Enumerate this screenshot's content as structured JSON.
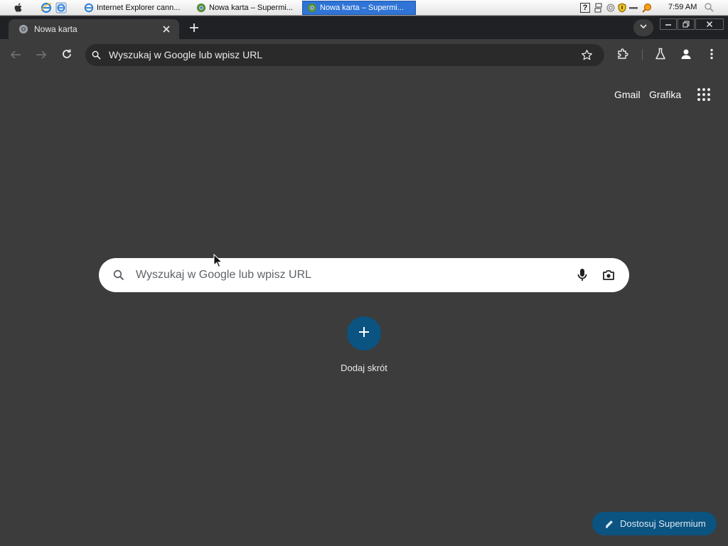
{
  "taskbar": {
    "tasks": [
      {
        "label": "Internet Explorer cann..."
      },
      {
        "label": "Nowa karta – Supermi..."
      },
      {
        "label": "Nowa karta – Supermi..."
      }
    ],
    "clock": "7:59 AM"
  },
  "browser": {
    "tab_title": "Nowa karta",
    "omnibox_text": "Wyszukaj w Google lub wpisz URL"
  },
  "ntp": {
    "links": {
      "gmail": "Gmail",
      "images": "Grafika"
    },
    "search_placeholder": "Wyszukaj w Google lub wpisz URL",
    "add_shortcut_label": "Dodaj skrót",
    "customize_label": "Dostosuj Supermium"
  },
  "colors": {
    "page_bg": "#3c3c3c",
    "accent": "#0b5380",
    "taskbar_active": "#2f74d6"
  },
  "icons": [
    "apple-icon",
    "ie-icon",
    "chrome-icon",
    "search-icon",
    "mic-icon",
    "camera-icon",
    "apps-grid-icon",
    "star-icon",
    "extensions-icon",
    "labs-icon",
    "profile-icon",
    "menu-dots-icon",
    "plus-icon",
    "pencil-icon"
  ]
}
